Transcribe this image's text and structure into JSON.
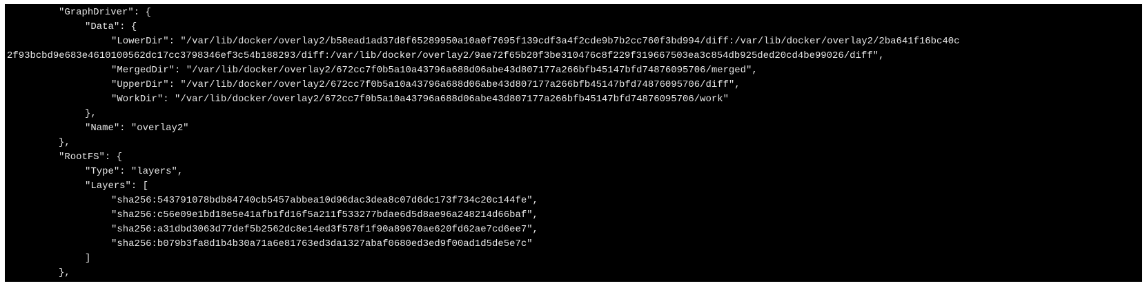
{
  "terminal": {
    "background": "#000000",
    "foreground": "#e8e8e8",
    "lines": [
      {
        "indent": 1,
        "text": "\"GraphDriver\": {"
      },
      {
        "indent": 2,
        "text": "\"Data\": {"
      },
      {
        "indent": 3,
        "text": "\"LowerDir\": \"/var/lib/docker/overlay2/b58ead1ad37d8f65289950a10a0f7695f139cdf3a4f2cde9b7b2cc760f3bd994/diff:/var/lib/docker/overlay2/2ba641f16bc40c"
      },
      {
        "indent": 0,
        "text": "2f93bcbd9e683e4610100562dc17cc3798346ef3c54b188293/diff:/var/lib/docker/overlay2/9ae72f65b20f3be310476c8f229f319667503ea3c854db925ded20cd4be99026/diff\","
      },
      {
        "indent": 3,
        "text": "\"MergedDir\": \"/var/lib/docker/overlay2/672cc7f0b5a10a43796a688d06abe43d807177a266bfb45147bfd74876095706/merged\","
      },
      {
        "indent": 3,
        "text": "\"UpperDir\": \"/var/lib/docker/overlay2/672cc7f0b5a10a43796a688d06abe43d807177a266bfb45147bfd74876095706/diff\","
      },
      {
        "indent": 3,
        "text": "\"WorkDir\": \"/var/lib/docker/overlay2/672cc7f0b5a10a43796a688d06abe43d807177a266bfb45147bfd74876095706/work\""
      },
      {
        "indent": 2,
        "text": "},"
      },
      {
        "indent": 2,
        "text": "\"Name\": \"overlay2\""
      },
      {
        "indent": 1,
        "text": "},"
      },
      {
        "indent": 1,
        "text": "\"RootFS\": {"
      },
      {
        "indent": 2,
        "text": "\"Type\": \"layers\","
      },
      {
        "indent": 2,
        "text": "\"Layers\": ["
      },
      {
        "indent": 3,
        "text": "\"sha256:543791078bdb84740cb5457abbea10d96dac3dea8c07d6dc173f734c20c144fe\","
      },
      {
        "indent": 3,
        "text": "\"sha256:c56e09e1bd18e5e41afb1fd16f5a211f533277bdae6d5d8ae96a248214d66baf\","
      },
      {
        "indent": 3,
        "text": "\"sha256:a31dbd3063d77def5b2562dc8e14ed3f578f1f90a89670ae620fd62ae7cd6ee7\","
      },
      {
        "indent": 3,
        "text": "\"sha256:b079b3fa8d1b4b30a71a6e81763ed3da1327abaf0680ed3ed9f00ad1d5de5e7c\""
      },
      {
        "indent": 2,
        "text": "]"
      },
      {
        "indent": 1,
        "text": "},"
      }
    ]
  }
}
